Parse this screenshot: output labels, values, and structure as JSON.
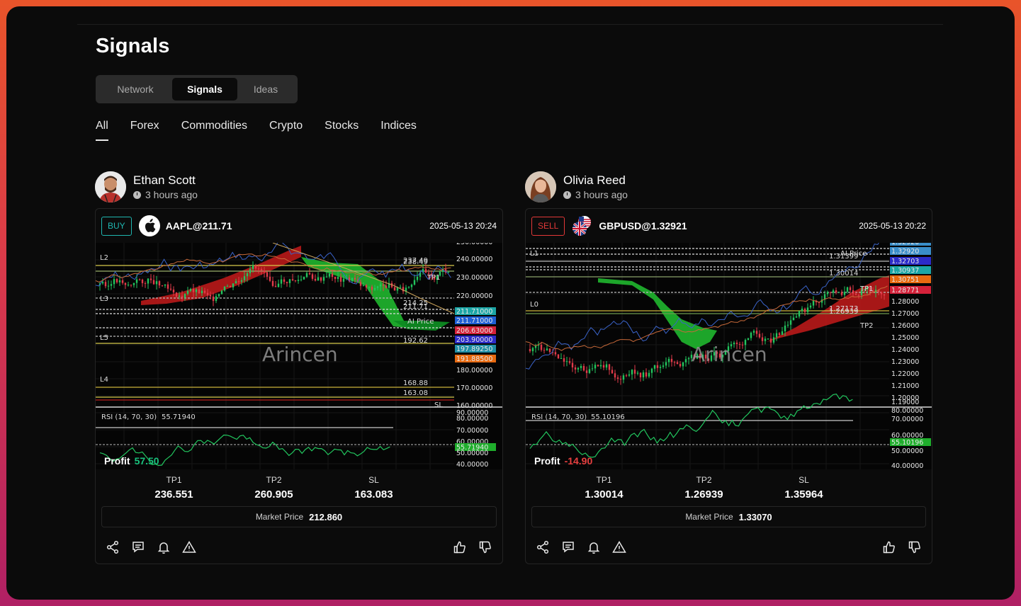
{
  "page": {
    "title": "Signals"
  },
  "tabs": [
    {
      "label": "Network"
    },
    {
      "label": "Signals"
    },
    {
      "label": "Ideas"
    }
  ],
  "filters": [
    {
      "label": "All"
    },
    {
      "label": "Forex"
    },
    {
      "label": "Commodities"
    },
    {
      "label": "Crypto"
    },
    {
      "label": "Stocks"
    },
    {
      "label": "Indices"
    }
  ],
  "cards": [
    {
      "author": "Ethan Scott",
      "time": "3 hours ago",
      "side": "BUY",
      "symbol": "AAPL@211.71",
      "icon": "apple-logo-icon",
      "date": "2025-05-13 20:24",
      "profit_label": "Profit",
      "profit_value": "57.50",
      "profit_color": "#19c37d",
      "tp1_label": "TP1",
      "tp1": "236.551",
      "tp2_label": "TP2",
      "tp2": "260.905",
      "sl_label": "SL",
      "sl": "163.083",
      "market_label": "Market Price",
      "market_price": "212.860",
      "chart": {
        "watermark": "Arincen",
        "rsi_label": "RSI (14, 70, 30)",
        "rsi_value": "55.71940",
        "price_labels": [
          "230.00000",
          "240.00000",
          "230.00000",
          "220.00000",
          "211.71000",
          "211.71000",
          "206.63000",
          "203.90000",
          "197.89250",
          "191.88500",
          "180.00000",
          "170.00000",
          "160.00000",
          "90.00000",
          "80.00000",
          "70.00000",
          "60.00000",
          "55.71940",
          "50.00000",
          "40.00000"
        ],
        "line_labels": [
          "L2",
          "L3",
          "L5",
          "L4",
          "TP1",
          "AI Price",
          "237.49",
          "238.49",
          "214.25",
          "211.71",
          "192.62",
          "168.88",
          "163.08",
          "SL"
        ]
      }
    },
    {
      "author": "Olivia Reed",
      "time": "3 hours ago",
      "side": "SELL",
      "symbol": "GBPUSD@1.32921",
      "icon": "uk-us-flag-icon",
      "date": "2025-05-13 20:22",
      "profit_label": "Profit",
      "profit_value": "-14.90",
      "profit_color": "#e84040",
      "tp1_label": "TP1",
      "tp1": "1.30014",
      "tp2_label": "TP2",
      "tp2": "1.26939",
      "sl_label": "SL",
      "sl": "1.35964",
      "market_label": "Market Price",
      "market_price": "1.33070",
      "chart": {
        "watermark": "Arincen",
        "rsi_label": "RSI (14, 70, 30)",
        "rsi_value": "55.10196",
        "price_labels": [
          "1.32920",
          "1.32920",
          "1.32703",
          "1.30937",
          "1.30751",
          "1.28771",
          "1.28000",
          "1.27000",
          "1.26000",
          "1.25000",
          "1.24000",
          "1.23000",
          "1.22000",
          "1.21000",
          "1.20000",
          "1.19000",
          "80.00000",
          "70.00000",
          "60.00000",
          "55.10196",
          "50.00000",
          "40.00000"
        ],
        "line_labels": [
          "L1",
          "L0",
          "AI Price",
          "TP1",
          "TP2",
          "1.31399",
          "1.30014",
          "1.27173",
          "1.26939"
        ]
      }
    }
  ]
}
